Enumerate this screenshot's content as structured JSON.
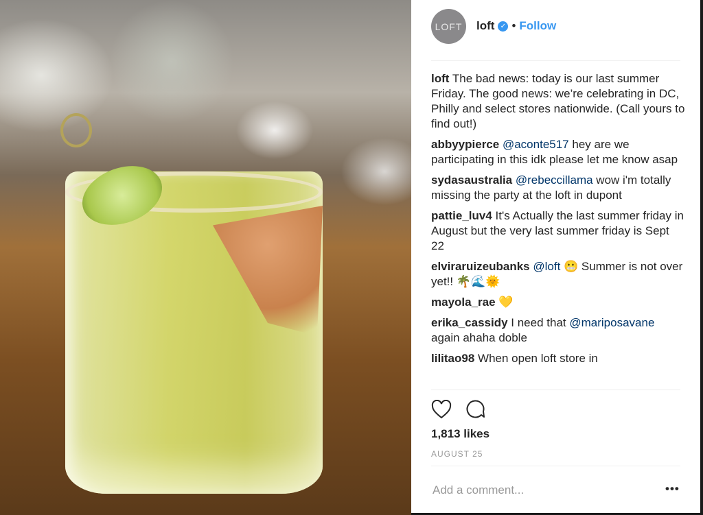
{
  "post": {
    "avatar_text": "LOFT",
    "username": "loft",
    "verified": true,
    "separator": "•",
    "follow_label": "Follow",
    "accent": "#3897f0",
    "comments": [
      {
        "user": "loft",
        "text": "The bad news: today is our last summer Friday. The good news: we’re celebrating in DC, Philly and select stores nationwide. (Call yours to find out!)"
      },
      {
        "user": "abbyypierce",
        "mention": "@aconte517",
        "text": "hey are we participating in this idk please let me know asap"
      },
      {
        "user": "sydasaustralia",
        "mention": "@rebeccillama",
        "text": "wow i'm totally missing the party at the loft in dupont"
      },
      {
        "user": "pattie_luv4",
        "text": "It's Actually the last summer friday in August but the very last summer friday is Sept 22"
      },
      {
        "user": "elviraruizeubanks",
        "mention": "@loft",
        "text": "😬 Summer is not over yet!! 🌴🌊🌞"
      },
      {
        "user": "mayola_rae",
        "text": "💛"
      },
      {
        "user": "erika_cassidy",
        "pre": "I need that",
        "mention": "@mariposavane",
        "text": "again ahaha doble"
      },
      {
        "user": "lilitao98",
        "text": "When open loft store in"
      }
    ],
    "likes": "1,813 likes",
    "date": "AUGUST 25",
    "comment_placeholder": "Add a comment...",
    "more_label": "•••",
    "icons": [
      "heart-icon",
      "comment-icon",
      "verified-badge-icon",
      "more-options-icon"
    ]
  }
}
